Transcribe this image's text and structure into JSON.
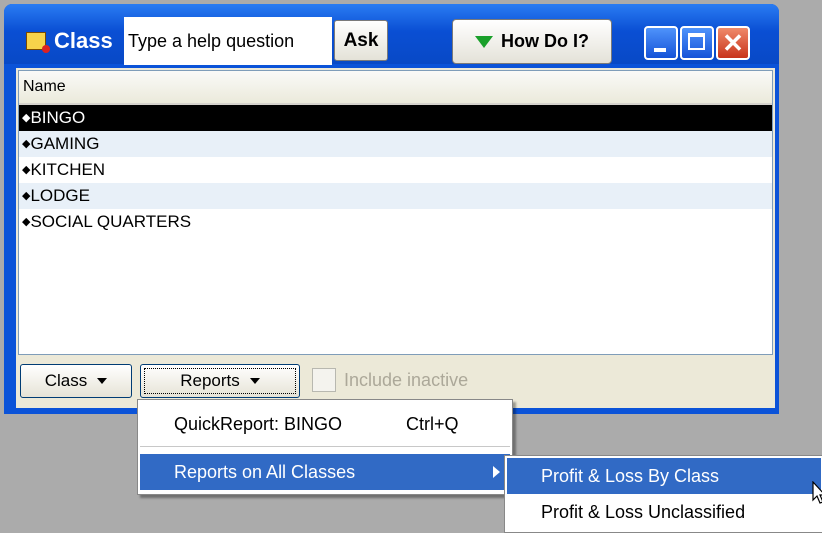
{
  "window": {
    "title": "Class",
    "help_placeholder": "Type a help question",
    "ask_label": "Ask",
    "howdoi_label": "How Do I?"
  },
  "list": {
    "column_header": "Name",
    "rows": [
      "BINGO",
      "GAMING",
      "KITCHEN",
      "LODGE",
      "SOCIAL QUARTERS"
    ],
    "selected_index": 0
  },
  "bottom": {
    "class_button": "Class",
    "reports_button": "Reports",
    "include_inactive": "Include inactive",
    "include_inactive_checked": false
  },
  "reports_menu": {
    "items": [
      {
        "label": "QuickReport: BINGO",
        "shortcut": "Ctrl+Q"
      },
      {
        "label": "Reports on All Classes"
      }
    ]
  },
  "submenu": {
    "items": [
      {
        "label": "Profit & Loss By Class"
      },
      {
        "label": "Profit & Loss Unclassified"
      }
    ]
  },
  "colors": {
    "titlebar": "#0b53d8",
    "highlight": "#316ac5",
    "selection": "#000000"
  }
}
